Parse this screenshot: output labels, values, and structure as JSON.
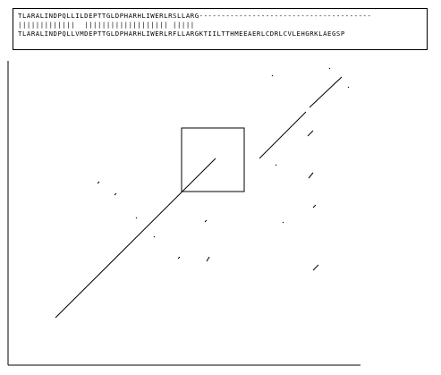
{
  "alignment": {
    "query": "TLARALINDPQLLILDEPTTGLDPHARHLIWERLRSLLARG---------------------------------------",
    "match": "|||||||||||||  ||||||||||||||||||| |||||",
    "subject": "TLARALINDPQLLVMDEPTTGLDPHARHLIWERLRFLLARGKTIILTTHMEEAERLCDRLCVLEHGRKLAEGSP"
  },
  "dot_plot": {
    "axes": "two lines, no labels",
    "highlight_box": true
  }
}
